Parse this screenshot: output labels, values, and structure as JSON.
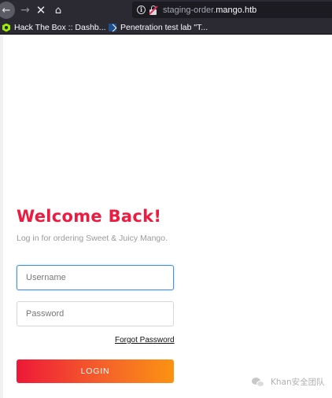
{
  "browser": {
    "url_prefix": "staging-order.",
    "url_host": "mango.htb",
    "bookmarks": [
      {
        "label": "Hack The Box :: Dashb..."
      },
      {
        "label": "Penetration test lab \"T..."
      }
    ]
  },
  "login": {
    "title": "Welcome Back!",
    "subtitle": "Log in for ordering Sweet & Juicy Mango.",
    "username_placeholder": "Username",
    "password_placeholder": "Password",
    "forgot_label": "Forgot Password",
    "login_label": "LOGIN"
  },
  "watermark": {
    "text": "Khan安全团队"
  },
  "colors": {
    "accent": "#ec1b3f",
    "gradient_start": "#ee1838",
    "gradient_end": "#fb9312",
    "focus_border": "#4a90d9"
  }
}
